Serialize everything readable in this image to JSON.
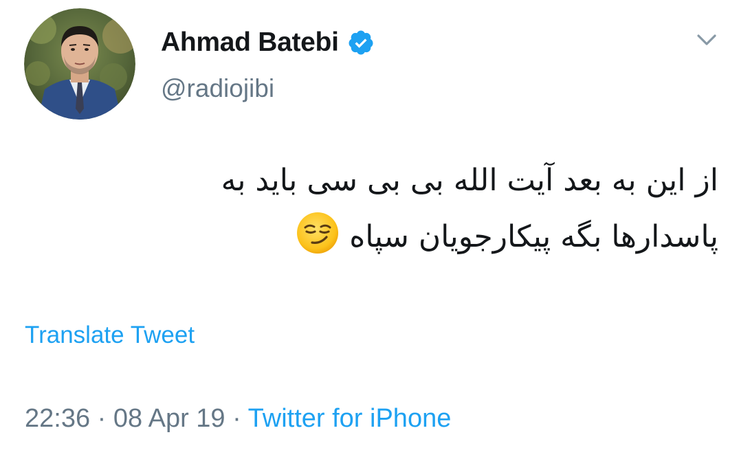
{
  "author": {
    "display_name": "Ahmad Batebi",
    "handle": "@radiojibi",
    "verified": true,
    "avatar_icon": "profile-photo"
  },
  "tweet": {
    "lines": [
      "از این به بعد آیت الله بی بی سی باید به",
      "پاسدارها بگه پیکارجویان سپاه"
    ],
    "emoji": "smirking-face-emoji"
  },
  "actions": {
    "translate_label": "Translate Tweet",
    "menu_icon": "chevron-down-icon"
  },
  "meta": {
    "time": "22:36",
    "separator": " · ",
    "date": "08 Apr 19",
    "source": "Twitter for iPhone"
  },
  "colors": {
    "link": "#1da1f2",
    "secondary_text": "#657786",
    "primary_text": "#14171a",
    "verified_badge": "#1da1f2"
  }
}
